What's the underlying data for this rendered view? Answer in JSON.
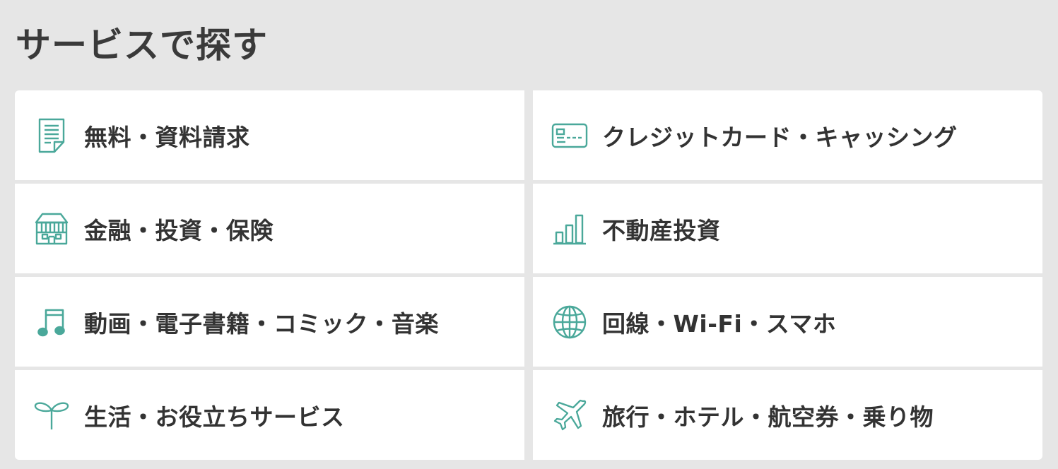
{
  "header": {
    "title": "サービスで探す"
  },
  "accent_color": "#4aa89a",
  "services": [
    {
      "label": "無料・資料請求",
      "icon": "document-icon"
    },
    {
      "label": "クレジットカード・キャッシング",
      "icon": "credit-card-icon"
    },
    {
      "label": "金融・投資・保険",
      "icon": "bank-building-icon"
    },
    {
      "label": "不動産投資",
      "icon": "bar-chart-icon"
    },
    {
      "label": "動画・電子書籍・コミック・音楽",
      "icon": "music-note-icon"
    },
    {
      "label": "回線・Wi-Fi・スマホ",
      "icon": "globe-icon"
    },
    {
      "label": "生活・お役立ちサービス",
      "icon": "sprout-icon"
    },
    {
      "label": "旅行・ホテル・航空券・乗り物",
      "icon": "airplane-icon"
    }
  ]
}
